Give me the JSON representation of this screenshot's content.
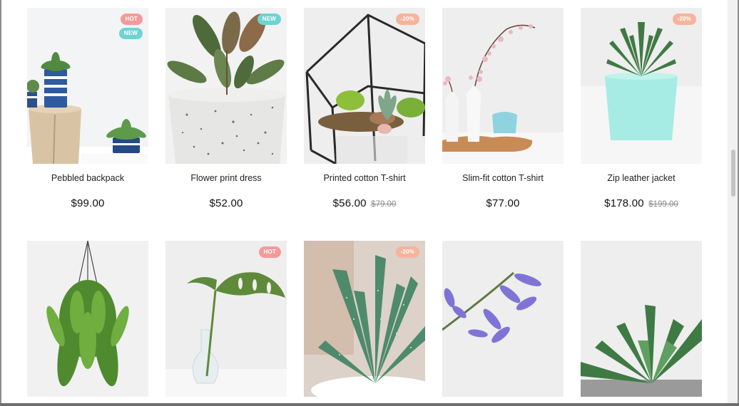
{
  "products": [
    {
      "name": "Pebbled backpack",
      "price": "$99.00",
      "old_price": "",
      "badges": [
        {
          "type": "hot",
          "label": "HOT"
        },
        {
          "type": "new",
          "label": "NEW"
        }
      ],
      "image": "potted-succulents-on-stools"
    },
    {
      "name": "Flower print dress",
      "price": "$52.00",
      "old_price": "",
      "badges": [
        {
          "type": "new",
          "label": "NEW"
        }
      ],
      "image": "rubber-plant-in-speckled-pot"
    },
    {
      "name": "Printed cotton T-shirt",
      "price": "$56.00",
      "old_price": "$79.00",
      "badges": [
        {
          "type": "sale",
          "label": "-20%"
        }
      ],
      "image": "glass-terrarium"
    },
    {
      "name": "Slim-fit cotton T-shirt",
      "price": "$77.00",
      "old_price": "",
      "badges": [],
      "image": "blossom-branch-in-vases"
    },
    {
      "name": "Zip leather jacket",
      "price": "$178.00",
      "old_price": "$199.00",
      "badges": [
        {
          "type": "sale",
          "label": "-20%"
        }
      ],
      "image": "succulent-in-mint-pot"
    },
    {
      "name": "",
      "price": "",
      "old_price": "",
      "badges": [],
      "image": "hanging-fern-basket"
    },
    {
      "name": "",
      "price": "",
      "old_price": "",
      "badges": [
        {
          "type": "hot",
          "label": "HOT"
        }
      ],
      "image": "monstera-leaf-in-glass-vase"
    },
    {
      "name": "",
      "price": "",
      "old_price": "",
      "badges": [
        {
          "type": "sale",
          "label": "-20%"
        }
      ],
      "image": "aloe-succulent-closeup"
    },
    {
      "name": "",
      "price": "",
      "old_price": "",
      "badges": [],
      "image": "purple-hyacinth-flower"
    },
    {
      "name": "",
      "price": "",
      "old_price": "",
      "badges": [],
      "image": "green-succulent-closeup"
    }
  ],
  "colors": {
    "badge_hot": "#f59a9a",
    "badge_new": "#6fd3d2",
    "badge_sale": "#f6b49c",
    "price_text": "#111111",
    "old_price_text": "#8a8a8a"
  }
}
